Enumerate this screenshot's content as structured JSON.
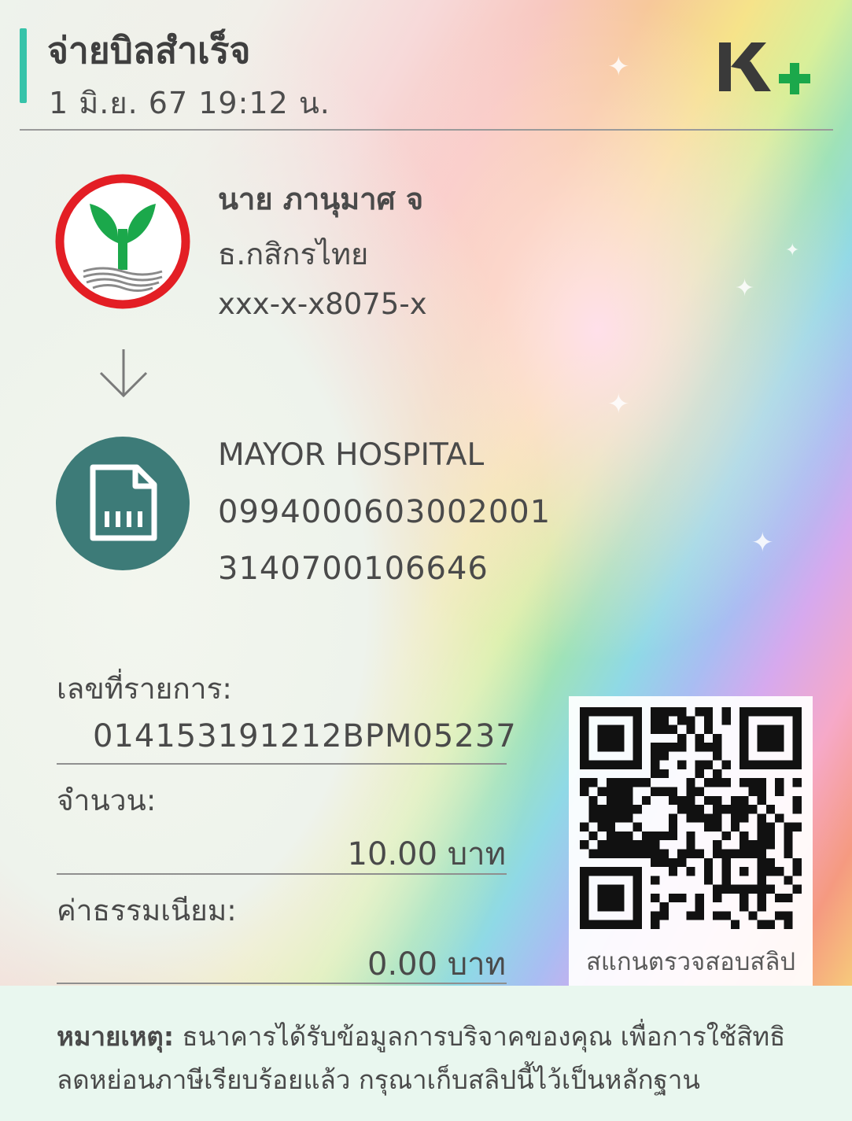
{
  "header": {
    "title": "จ่ายบิลสำเร็จ",
    "datetime": "1 มิ.ย. 67  19:12 น.",
    "logo_text": "K+"
  },
  "payer": {
    "name": "นาย ภานุมาศ จ",
    "bank": "ธ.กสิกรไทย",
    "account": "xxx-x-x8075-x"
  },
  "biller": {
    "name": "MAYOR HOSPITAL",
    "ref1": "099400060300200​1",
    "ref2": "3140700106646"
  },
  "transaction": {
    "id_label": "เลขที่รายการ:",
    "id_value": "014153191212BPM05237",
    "amount_label": "จำนวน:",
    "amount_value": "10.00 บาท",
    "fee_label": "ค่าธรรมเนียม:",
    "fee_value": "0.00 บาท"
  },
  "qr": {
    "caption": "สแกนตรวจสอบสลิป"
  },
  "note": {
    "label": "หมายเหตุ:",
    "text": " ธนาคารได้รับข้อมูลการบริจาคของคุณ เพื่อการใช้สิทธิลดหย่อนภาษีเรียบร้อยแล้ว กรุณาเก็บสลิปนี้ไว้เป็นหลักฐาน"
  },
  "colors": {
    "accent": "#36c3a9",
    "kbank_green": "#1ba84b",
    "kbank_red": "#e31e24",
    "biller_icon_bg": "#3d7b78"
  },
  "icons": {
    "bank": "kasikorn-bank-logo",
    "arrow": "arrow-down-icon",
    "biller": "bill-document-icon",
    "sparkle": "sparkle-icon"
  }
}
